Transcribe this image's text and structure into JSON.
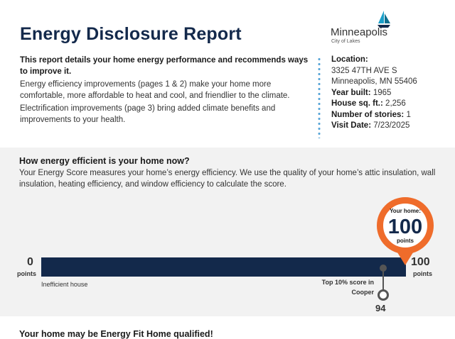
{
  "report": {
    "title": "Energy Disclosure Report",
    "intro_bold": "This report details your home energy performance and recommends ways to improve it.",
    "paragraph1": "Energy efficiency improvements (pages 1 & 2) make your home more comfortable, more affordable to heat and cool, and friendlier to the climate.",
    "paragraph2": "Electrification improvements (page 3) bring added climate benefits and improvements to your health."
  },
  "logo": {
    "name": "Minneapolis",
    "tagline": "City of Lakes",
    "icon": "sailboat-icon",
    "color": "#1a9fc9"
  },
  "property": {
    "location_label": "Location:",
    "address_line1": "3325 47TH AVE S",
    "address_line2": "Minneapolis, MN 55406",
    "year_built_label": "Year built:",
    "year_built": "1965",
    "sqft_label": "House sq. ft.:",
    "sqft": "2,256",
    "stories_label": "Number of stories:",
    "stories": "1",
    "visit_label": "Visit Date:",
    "visit_date": "7/23/2025"
  },
  "score_section": {
    "heading": "How energy efficient is your home now?",
    "description": "Your Energy Score measures your home’s energy efficiency. We use the quality of your home’s attic insulation, wall insulation, heating efficiency, and window efficiency to calculate the score.",
    "scale_min": "0",
    "scale_min_unit": "points",
    "scale_max": "100",
    "scale_max_unit": "points",
    "min_caption": "Inefficient house",
    "your_home_label": "Your home:",
    "your_home_score": "100",
    "your_home_unit": "points",
    "top10_label": "Top 10% score in Cooper",
    "top10_value": "94"
  },
  "colors": {
    "navy": "#13294b",
    "orange": "#ef6c2b",
    "band": "#f2f2f2",
    "dots": "#5aa6d8"
  },
  "next_heading": "Your home may be Energy Fit Home qualified!"
}
